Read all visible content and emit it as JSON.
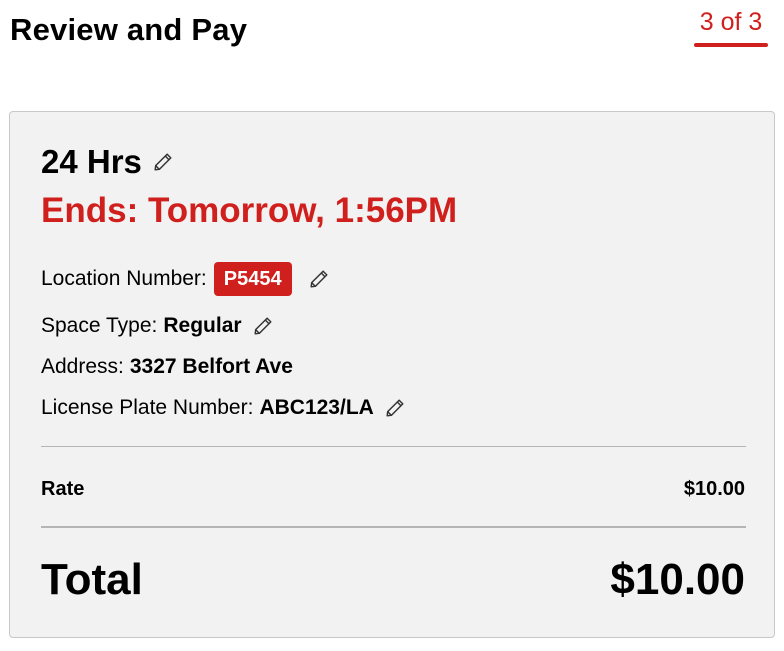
{
  "header": {
    "title": "Review and Pay",
    "step": "3 of 3",
    "accent_color": "#d0201d"
  },
  "summary": {
    "duration": "24 Hrs",
    "ends": "Ends: Tomorrow, 1:56PM",
    "edit_icon": "pencil-icon"
  },
  "details": {
    "location_label": "Location Number:",
    "location_value": "P5454",
    "space_type_label": "Space Type:",
    "space_type_value": "Regular",
    "address_label": "Address:",
    "address_value": "3327 Belfort Ave",
    "plate_label": "License Plate Number:",
    "plate_value": "ABC123/LA"
  },
  "pricing": {
    "rate_label": "Rate",
    "rate_value": "$10.00",
    "total_label": "Total",
    "total_value": "$10.00"
  }
}
